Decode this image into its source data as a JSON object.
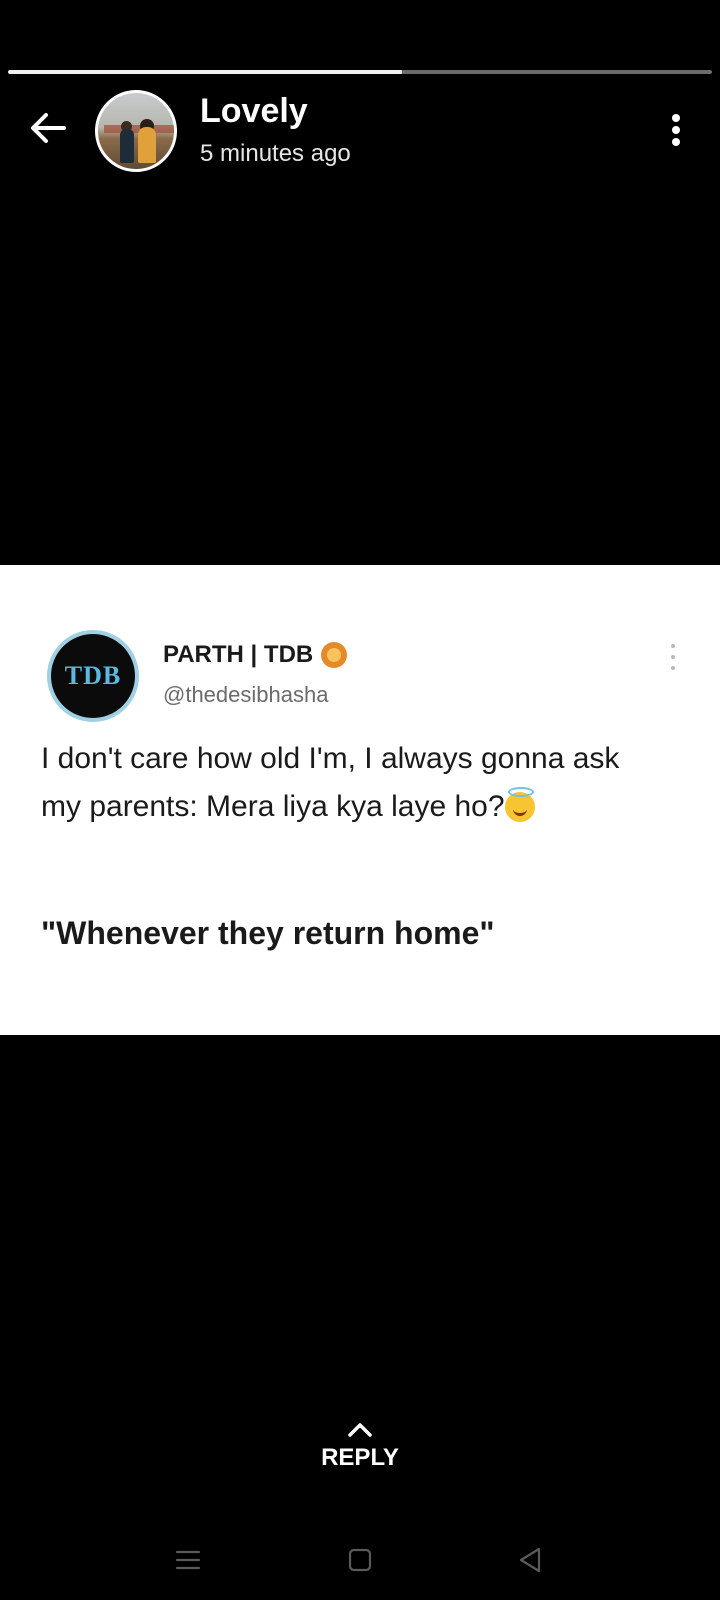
{
  "status": {
    "progress": 0.56
  },
  "header": {
    "back_icon": "arrow-left-icon",
    "user_name": "Lovely",
    "posted_time": "5 minutes ago",
    "menu_icon": "more-vertical-icon"
  },
  "post": {
    "author_name": "PARTH | TDB",
    "author_badge_icon": "lion-emoji-icon",
    "handle": "@thedesibhasha",
    "avatar_logo_text": "TDB",
    "body": "I don't care how old I'm, I always gonna ask my parents: Mera liya kya laye ho?",
    "body_emoji_icon": "smiling-face-with-halo-icon",
    "quote": "\"Whenever they return home\""
  },
  "reply": {
    "icon": "chevron-up-icon",
    "label": "REPLY"
  },
  "navbar": {
    "menu_icon": "recents-menu-icon",
    "home_icon": "home-square-icon",
    "back_icon": "back-triangle-icon"
  },
  "colors": {
    "background": "#000000",
    "progress_active": "#f2f2f2",
    "progress_track": "#6b6b6b",
    "card_background": "#ffffff"
  }
}
